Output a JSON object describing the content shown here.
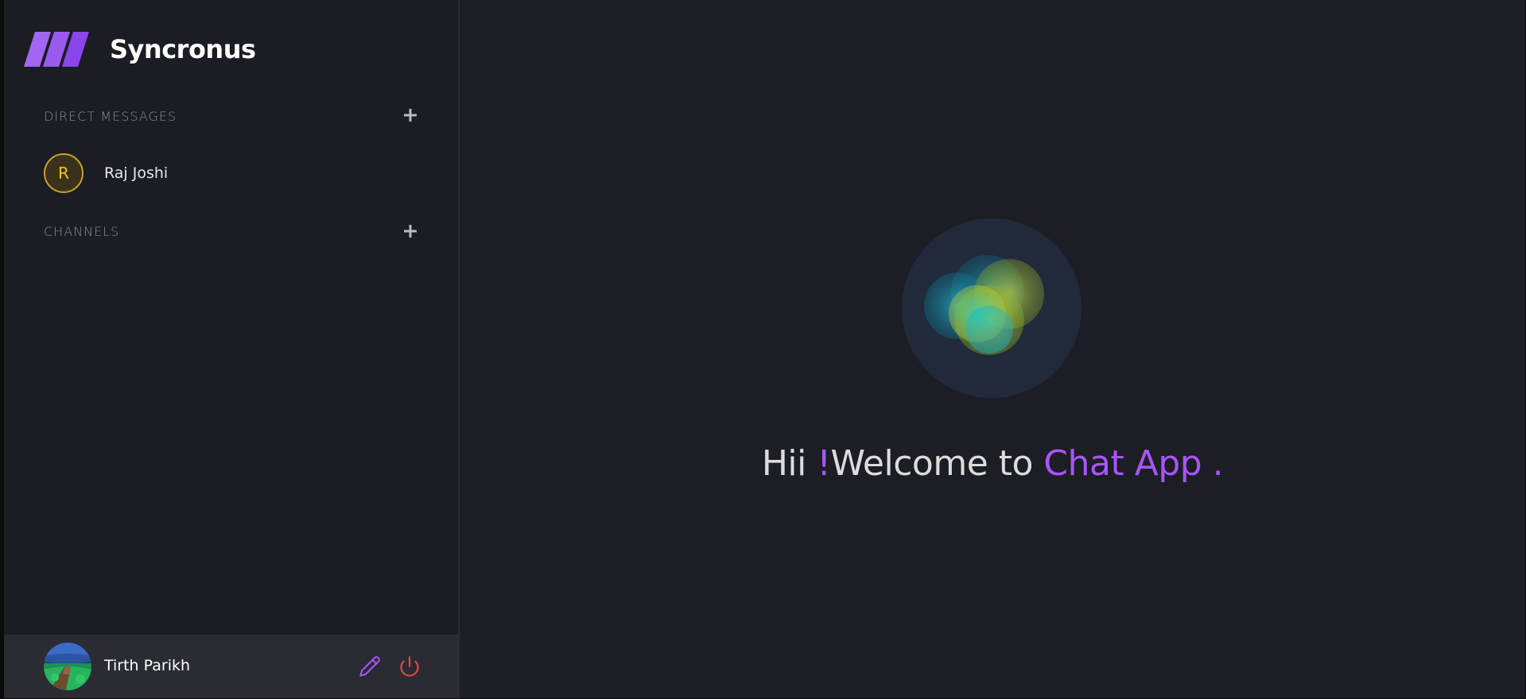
{
  "app": {
    "name": "Syncronus",
    "accent": "#a855f7"
  },
  "sidebar": {
    "direct_messages": {
      "title": "DIRECT MESSAGES",
      "add_icon": "plus-icon",
      "items": [
        {
          "initial": "R",
          "name": "Raj Joshi",
          "avatar_color": "#f2c21a"
        }
      ]
    },
    "channels": {
      "title": "CHANNELS",
      "add_icon": "plus-icon",
      "items": []
    },
    "profile": {
      "name": "Tirth Parikh",
      "edit_icon": "pencil-icon",
      "logout_icon": "power-icon",
      "edit_color": "#a855f7",
      "logout_color": "#ef4444"
    }
  },
  "main": {
    "welcome": {
      "greeting": "Hii ",
      "exclaim": "!",
      "middle": "Welcome to ",
      "app_name": "Chat App .",
      "highlight_color": "#a855f7"
    }
  }
}
